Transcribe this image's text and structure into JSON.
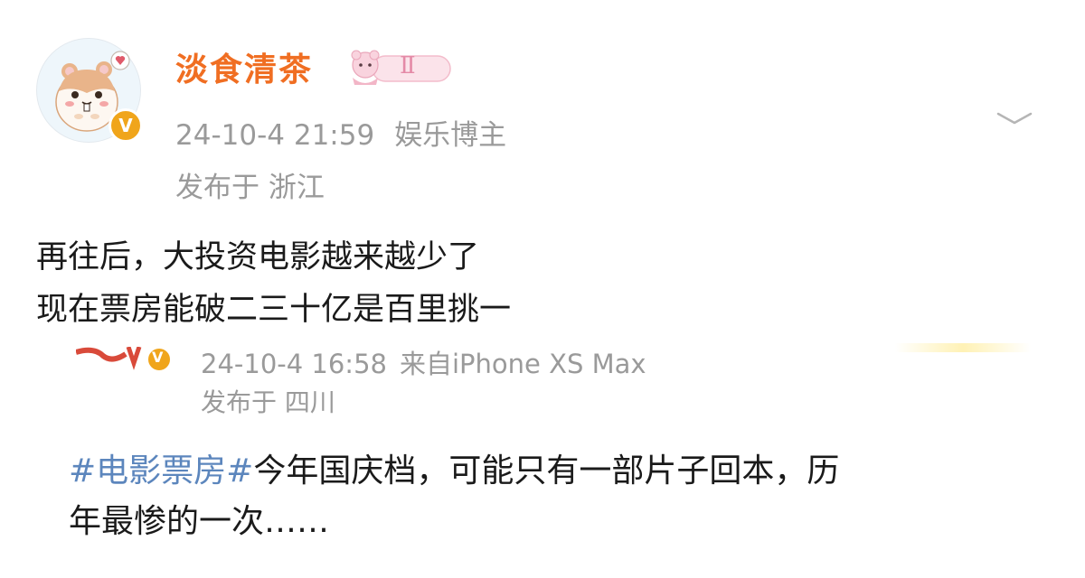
{
  "colors": {
    "username": "#f06e22",
    "meta": "#9a9a9a",
    "body": "#1a1a1a",
    "hashtag": "#5c86bd",
    "verified_badge": "#f0a51b"
  },
  "post": {
    "avatar_icon": "hamster-avatar-icon",
    "verified_icon": "verified-v-badge-icon",
    "verified_label": "V",
    "level_badge_icon": "pink-bear-level-badge-icon",
    "level_badge_text": "Ⅱ",
    "username": "淡食清茶",
    "timestamp": "24-10-4 21:59",
    "role": "娱乐博主",
    "location": "发布于 浙江",
    "more_icon": "chevron-down-icon",
    "lines": [
      "再往后，大投资电影越来越少了",
      "现在票房能破二三十亿是百里挑一"
    ]
  },
  "quoted": {
    "verified_icon": "verified-v-badge-icon",
    "verified_label": "V",
    "timestamp": "24-10-4 16:58",
    "source": "来自iPhone XS Max",
    "location": "发布于 四川",
    "hashtag": "#电影票房#",
    "line1_rest": "今年国庆档，可能只有一部片子回本，历",
    "line2": "年最惨的一次……"
  }
}
